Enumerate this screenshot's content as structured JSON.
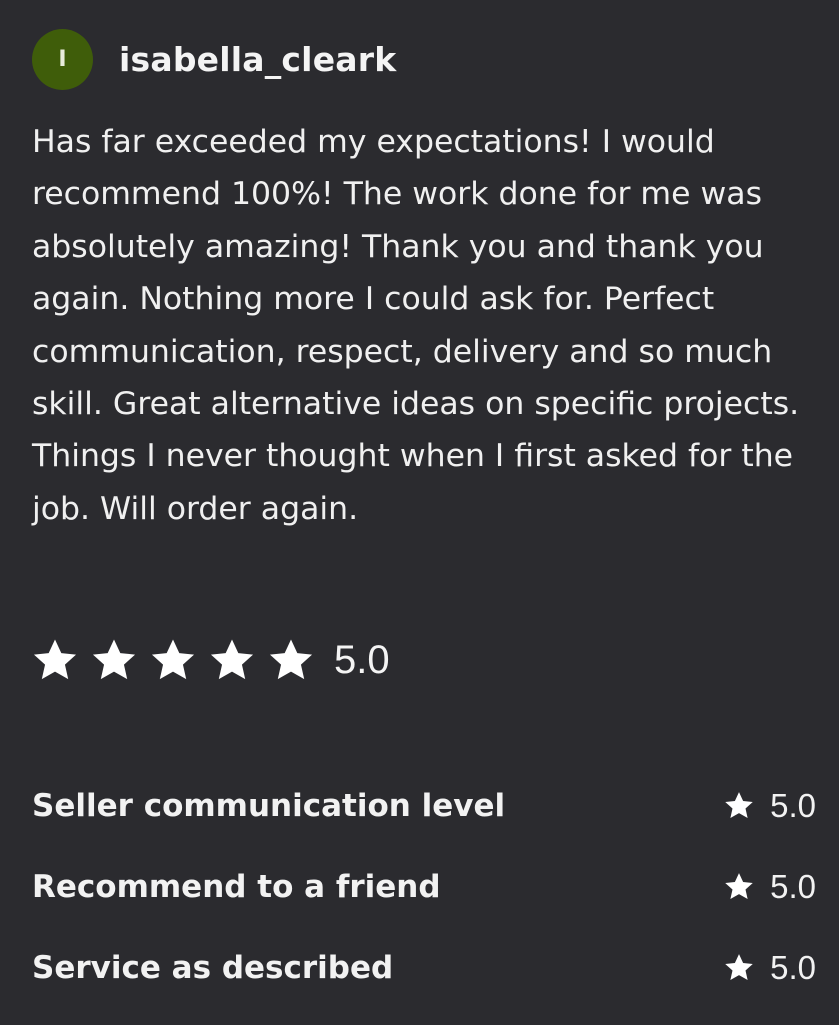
{
  "review": {
    "author": {
      "avatar_initial": "I",
      "avatar_color": "#3f5d0a",
      "username": "isabella_cleark"
    },
    "text": "Has far exceeded my expectations! I would recommend 100%! The work done for me was absolutely amazing! Thank you and thank you again. Nothing more I could ask for. Perfect communication, respect, delivery and so much skill. Great alternative ideas on specific projects. Things I never thought when I first asked for the job. Will order again.",
    "rating": {
      "stars": 5,
      "max_stars": 5,
      "value": "5.0",
      "star_icon": "star-icon"
    },
    "sub_ratings": [
      {
        "label": "Seller communication level",
        "value": "5.0"
      },
      {
        "label": "Recommend to a friend",
        "value": "5.0"
      },
      {
        "label": "Service as described",
        "value": "5.0"
      }
    ]
  },
  "colors": {
    "background": "#2b2b2f",
    "text": "#f2f2f2",
    "star": "#ffffff"
  }
}
